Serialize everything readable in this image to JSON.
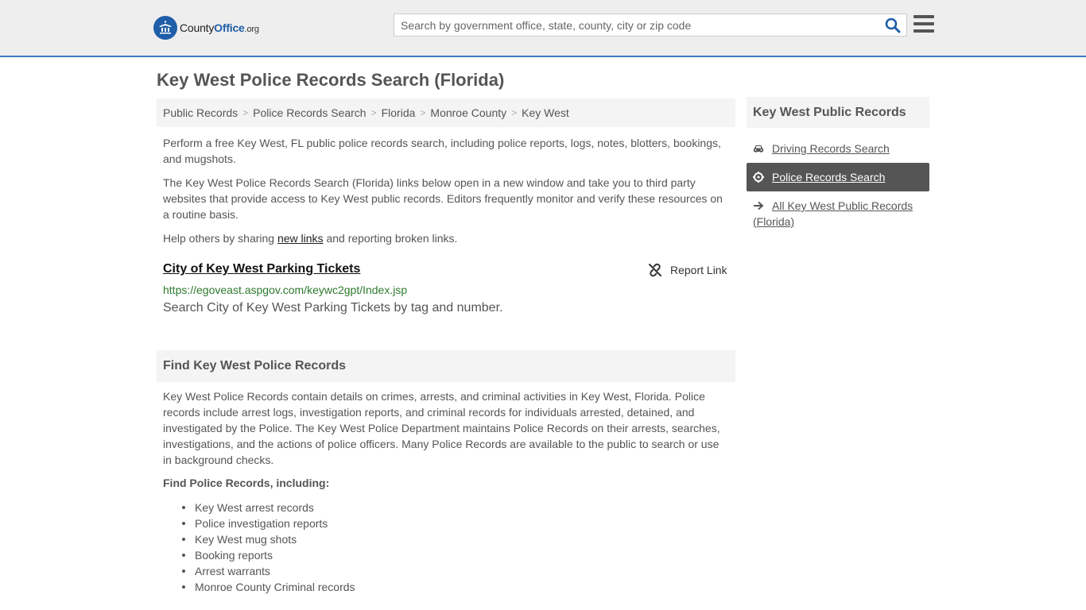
{
  "header": {
    "logo": {
      "part1": "County",
      "part2": "Office",
      "tld": ".org"
    },
    "search": {
      "placeholder": "Search by government office, state, county, city or zip code"
    }
  },
  "page": {
    "title": "Key West Police Records Search (Florida)",
    "breadcrumb": [
      "Public Records",
      "Police Records Search",
      "Florida",
      "Monroe County",
      "Key West"
    ]
  },
  "intro": {
    "p1": "Perform a free Key West, FL public police records search, including police reports, logs, notes, blotters, bookings, and mugshots.",
    "p2": "The Key West Police Records Search (Florida) links below open in a new window and take you to third party websites that provide access to Key West public records. Editors frequently monitor and verify these resources on a routine basis.",
    "p3_before": "Help others by sharing ",
    "p3_link": "new links",
    "p3_after": " and reporting broken links."
  },
  "listing": {
    "title": "City of Key West Parking Tickets",
    "report_label": "Report Link",
    "url": "https://egoveast.aspgov.com/keywc2gpt/Index.jsp",
    "description": "Search City of Key West Parking Tickets by tag and number."
  },
  "find_section": {
    "heading": "Find Key West Police Records",
    "body": "Key West Police Records contain details on crimes, arrests, and criminal activities in Key West, Florida. Police records include arrest logs, investigation reports, and criminal records for individuals arrested, detained, and investigated by the Police. The Key West Police Department maintains Police Records on their arrests, searches, investigations, and the actions of police officers. Many Police Records are available to the public to search or use in background checks.",
    "subheading": "Find Police Records, including:",
    "items": [
      "Key West arrest records",
      "Police investigation reports",
      "Key West mug shots",
      "Booking reports",
      "Arrest warrants",
      "Monroe County Criminal records"
    ]
  },
  "sidebar": {
    "heading": "Key West Public Records",
    "items": [
      {
        "label": "Driving Records Search",
        "icon": "car-icon"
      },
      {
        "label": "Police Records Search",
        "icon": "crosshair-icon",
        "active": true
      },
      {
        "label": "All Key West Public Records (Florida)",
        "icon": "arrow-right-icon"
      }
    ]
  },
  "colors": {
    "accent": "#3a7cc2",
    "brand": "#1f5ea8",
    "url_green": "#2d7a2d",
    "active_bg": "#555555"
  }
}
